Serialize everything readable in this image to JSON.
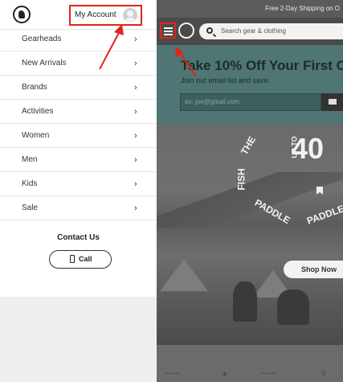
{
  "menu": {
    "account_label": "My Account",
    "items": [
      {
        "label": "Gearheads"
      },
      {
        "label": "New Arrivals"
      },
      {
        "label": "Brands"
      },
      {
        "label": "Activities"
      },
      {
        "label": "Women"
      },
      {
        "label": "Men"
      },
      {
        "label": "Kids"
      },
      {
        "label": "Sale"
      }
    ],
    "chevron": "›",
    "contact_title": "Contact Us",
    "call_label": "Call"
  },
  "page": {
    "promo": "Free 2-Day Shipping on O",
    "search_placeholder": "Search gear & clothing",
    "hero_title": "Take 10% Off Your First O",
    "hero_sub": "Join our email list and save.",
    "email_placeholder": "ex: joe@gmail.com",
    "banner_upto": "UP TO",
    "banner_pct": "40",
    "banner_words": [
      "THE",
      "FISH",
      "PADDLE",
      "PADDLE"
    ],
    "shop_now": "Shop Now"
  },
  "colors": {
    "highlight": "#e0251a",
    "overlay": "#6e6e6e"
  }
}
